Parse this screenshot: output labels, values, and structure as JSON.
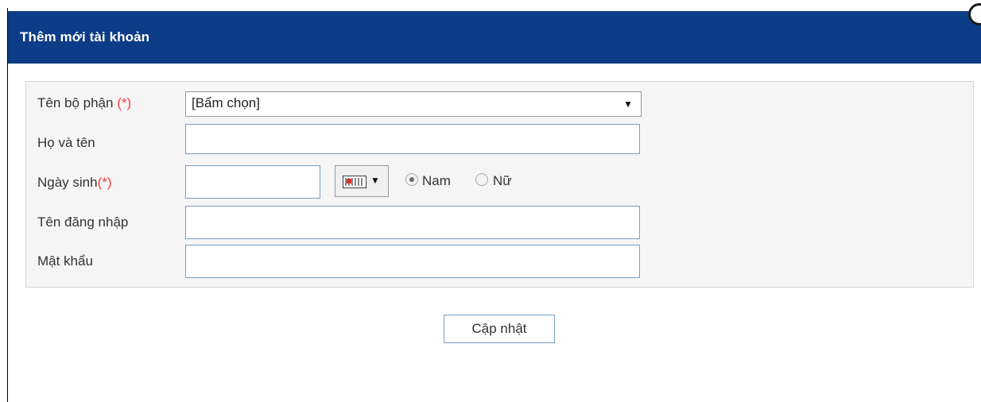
{
  "dialog": {
    "title": "Thêm mới tài khoản",
    "close_icon": "close-icon"
  },
  "form": {
    "department": {
      "label": "Tên bộ phận ",
      "required_mark": "(*)",
      "selected_value": "[Bấm chọn]",
      "arrow_icon": "chevron-down-icon"
    },
    "fullname": {
      "label": "Họ và tên",
      "value": ""
    },
    "birthdate": {
      "label": "Ngày sinh",
      "required_mark": "(*)",
      "value": "",
      "calendar_icon": "calendar-icon"
    },
    "gender": {
      "options": [
        {
          "label": "Nam",
          "checked": true
        },
        {
          "label": "Nữ",
          "checked": false
        }
      ]
    },
    "username": {
      "label": "Tên đăng nhập",
      "value": ""
    },
    "password": {
      "label": "Mật khẩu",
      "value": ""
    },
    "submit_label": "Cập nhật"
  },
  "colors": {
    "titlebar": "#0d3d86",
    "required": "#ff3b3b",
    "input_border": "#7a9cc6"
  }
}
